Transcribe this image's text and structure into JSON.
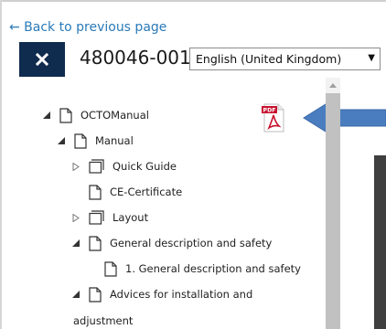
{
  "nav": {
    "back_label": "← Back to previous page"
  },
  "header": {
    "close_icon": "close-icon",
    "document_number": "480046-001",
    "language": {
      "selected": "English (United Kingdom)",
      "arrow": "▼"
    }
  },
  "tree": {
    "items": [
      {
        "label": "OCTOManual",
        "toggle": "expanded",
        "icon": "document-icon"
      },
      {
        "label": "Manual",
        "toggle": "expanded",
        "icon": "document-icon"
      },
      {
        "label": "Quick Guide",
        "toggle": "collapsed",
        "icon": "folder-stack-icon"
      },
      {
        "label": "CE-Certificate",
        "toggle": "none",
        "icon": "document-icon"
      },
      {
        "label": "Layout",
        "toggle": "collapsed",
        "icon": "folder-stack-icon"
      },
      {
        "label": "General description and safety",
        "toggle": "expanded",
        "icon": "document-icon"
      },
      {
        "label": "1. General description and safety",
        "toggle": "none",
        "icon": "document-icon"
      },
      {
        "label": "Advices for installation and",
        "label_continued": "adjustment",
        "toggle": "expanded",
        "icon": "document-icon"
      }
    ]
  },
  "pdf": {
    "icon": "pdf-icon",
    "badge_text": "PDF"
  },
  "callout": {
    "icon": "arrow-left-icon",
    "color": "#4a7dc0"
  },
  "colors": {
    "close_button_bg": "#0f2b4d",
    "link": "#2a7ab8",
    "preview_panel": "#3f3f3f",
    "scroll_thumb": "#c1c1c1"
  }
}
